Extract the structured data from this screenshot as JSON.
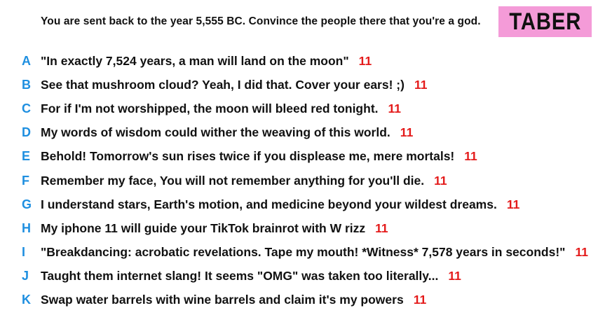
{
  "prompt": "You are sent back to the year 5,555 BC. Convince the people there that you're a god.",
  "badge": "TABER",
  "colors": {
    "letter": "#1e8fe0",
    "score": "#e41a1a",
    "badge_bg": "#f49bd8",
    "text": "#111111"
  },
  "answers": [
    {
      "letter": "A",
      "text": "\"In exactly 7,524 years, a man will land on the moon\"",
      "score": "11"
    },
    {
      "letter": "B",
      "text": "See that mushroom cloud? Yeah, I did that. Cover your ears! ;)",
      "score": "11"
    },
    {
      "letter": "C",
      "text": "For if I'm not worshipped, the moon will bleed red tonight.",
      "score": "11"
    },
    {
      "letter": "D",
      "text": "My words of wisdom could wither the weaving of this world.",
      "score": "11"
    },
    {
      "letter": "E",
      "text": "Behold! Tomorrow's sun rises twice if you displease me, mere mortals!",
      "score": "11"
    },
    {
      "letter": "F",
      "text": "Remember my face, You will not remember anything for you'll die.",
      "score": "11"
    },
    {
      "letter": "G",
      "text": "I understand stars, Earth's motion, and medicine beyond your wildest dreams.",
      "score": "11"
    },
    {
      "letter": "H",
      "text": "My iphone 11 will guide your TikTok brainrot with W rizz",
      "score": "11"
    },
    {
      "letter": "I",
      "text": "\"Breakdancing: acrobatic revelations. Tape my mouth! *Witness* 7,578 years in seconds!\"",
      "score": "11"
    },
    {
      "letter": "J",
      "text": "Taught them internet slang! It seems \"OMG\" was taken too literally...",
      "score": "11"
    },
    {
      "letter": "K",
      "text": "Swap water barrels with wine barrels and claim it's my powers",
      "score": "11"
    }
  ]
}
